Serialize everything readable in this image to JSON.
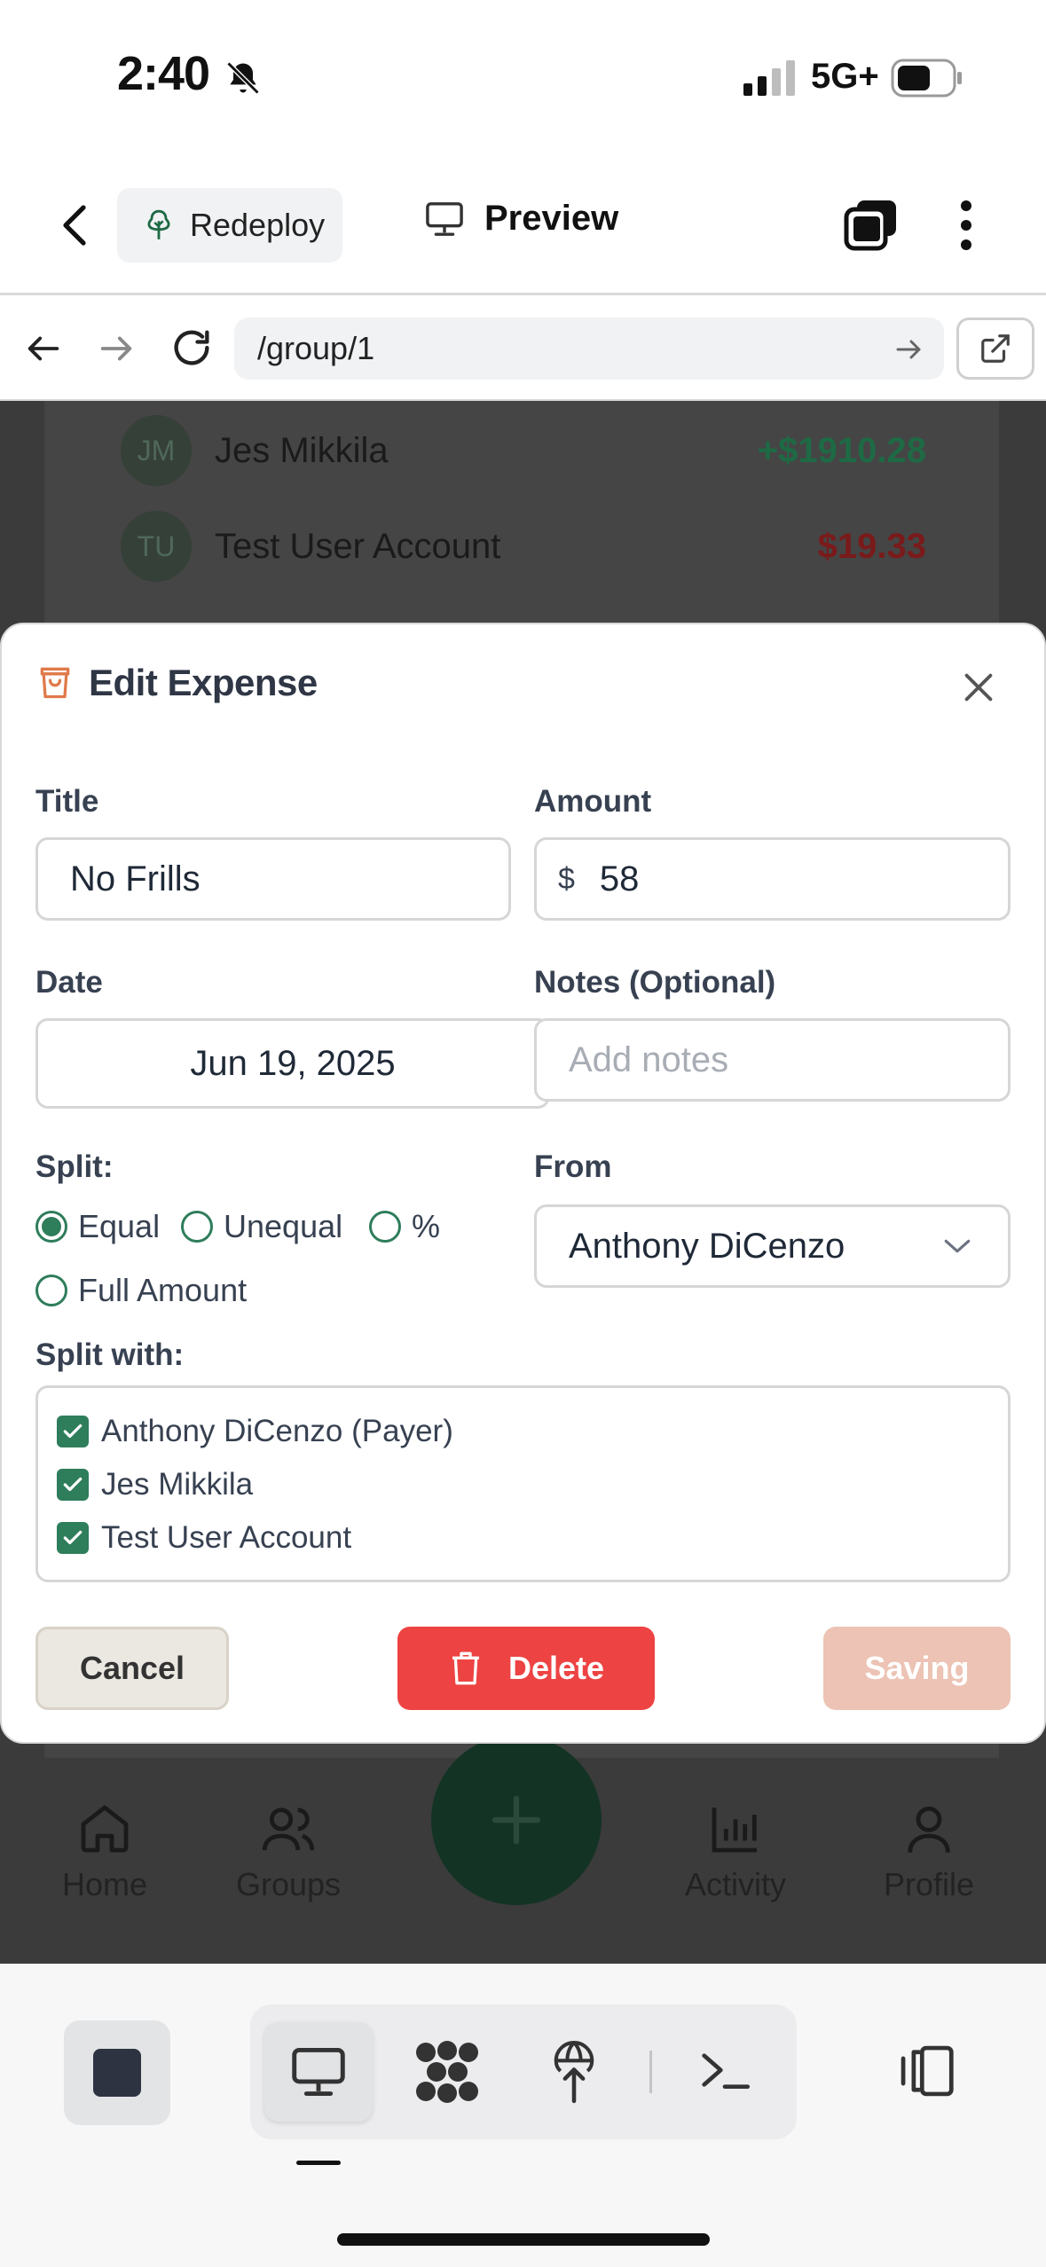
{
  "status_bar": {
    "time": "2:40",
    "network": "5G+"
  },
  "header": {
    "redeploy_label": "Redeploy",
    "preview_label": "Preview"
  },
  "url_bar": {
    "url": "/group/1"
  },
  "background": {
    "members": [
      {
        "initials": "JM",
        "name": "Jes Mikkila",
        "amount": "+$1910.28",
        "color": "#1e6a45"
      },
      {
        "initials": "TU",
        "name": "Test User Account",
        "amount": "$19.33",
        "color": "#7a1a1a"
      }
    ],
    "nav": {
      "home": "Home",
      "groups": "Groups",
      "activity": "Activity",
      "profile": "Profile"
    }
  },
  "modal": {
    "title": "Edit Expense",
    "title_label": "Title",
    "title_value": "No Frills",
    "amount_label": "Amount",
    "currency": "$",
    "amount_value": "58",
    "date_label": "Date",
    "date_value": "Jun 19, 2025",
    "notes_label": "Notes (Optional)",
    "notes_placeholder": "Add notes",
    "split_label": "Split:",
    "split_options": {
      "equal": "Equal",
      "unequal": "Unequal",
      "percent": "%",
      "full": "Full Amount"
    },
    "split_selected": "Equal",
    "from_label": "From",
    "from_value": "Anthony DiCenzo",
    "split_with_label": "Split with:",
    "split_with": [
      {
        "name": "Anthony DiCenzo (Payer)",
        "checked": true
      },
      {
        "name": "Jes Mikkila",
        "checked": true
      },
      {
        "name": "Test User Account",
        "checked": true
      }
    ],
    "cancel_label": "Cancel",
    "delete_label": "Delete",
    "saving_label": "Saving",
    "colors": {
      "accent": "#2e7d5b",
      "delete": "#ee4343",
      "saving": "#ecc3b4"
    }
  }
}
